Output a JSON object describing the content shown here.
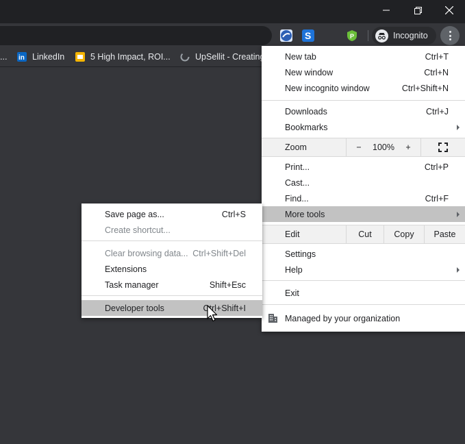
{
  "window": {
    "minimize_icon": "minimize-icon",
    "restore_icon": "restore-icon",
    "close_icon": "close-icon"
  },
  "toolbar": {
    "extensions": [
      "extension-icon-1",
      "extension-icon-2",
      "vpn-shield-icon"
    ],
    "incognito_label": "Incognito",
    "menu_icon": "kebab-menu-icon"
  },
  "bookmarks": [
    {
      "label": "...",
      "icon": "none"
    },
    {
      "label": "LinkedIn",
      "icon": "linkedin-icon"
    },
    {
      "label": "5 High Impact, ROI...",
      "icon": "slides-icon"
    },
    {
      "label": "UpSellit - Creating",
      "icon": "spinner-icon"
    }
  ],
  "main_menu": {
    "items": {
      "new_tab": {
        "label": "New tab",
        "shortcut": "Ctrl+T"
      },
      "new_window": {
        "label": "New window",
        "shortcut": "Ctrl+N"
      },
      "new_incognito": {
        "label": "New incognito window",
        "shortcut": "Ctrl+Shift+N"
      },
      "downloads": {
        "label": "Downloads",
        "shortcut": "Ctrl+J"
      },
      "bookmarks": {
        "label": "Bookmarks"
      },
      "zoom": {
        "label": "Zoom",
        "minus": "−",
        "value": "100%",
        "plus": "+",
        "fullscreen_icon": "fullscreen-icon"
      },
      "print": {
        "label": "Print...",
        "shortcut": "Ctrl+P"
      },
      "cast": {
        "label": "Cast..."
      },
      "find": {
        "label": "Find...",
        "shortcut": "Ctrl+F"
      },
      "more_tools": {
        "label": "More tools"
      },
      "edit": {
        "label": "Edit",
        "cut": "Cut",
        "copy": "Copy",
        "paste": "Paste"
      },
      "settings": {
        "label": "Settings"
      },
      "help": {
        "label": "Help"
      },
      "exit": {
        "label": "Exit"
      },
      "managed": {
        "label": "Managed by your organization",
        "icon": "building-icon"
      }
    }
  },
  "submenu": {
    "save_page": {
      "label": "Save page as...",
      "shortcut": "Ctrl+S"
    },
    "create_shortcut": {
      "label": "Create shortcut..."
    },
    "clear_browsing": {
      "label": "Clear browsing data...",
      "shortcut": "Ctrl+Shift+Del"
    },
    "extensions": {
      "label": "Extensions"
    },
    "task_manager": {
      "label": "Task manager",
      "shortcut": "Shift+Esc"
    },
    "developer_tools": {
      "label": "Developer tools",
      "shortcut": "Ctrl+Shift+I"
    }
  },
  "colors": {
    "titlebar": "#202124",
    "toolbar": "#35363a",
    "menu_bg": "#ffffff",
    "highlight": "#c2c2c2"
  }
}
